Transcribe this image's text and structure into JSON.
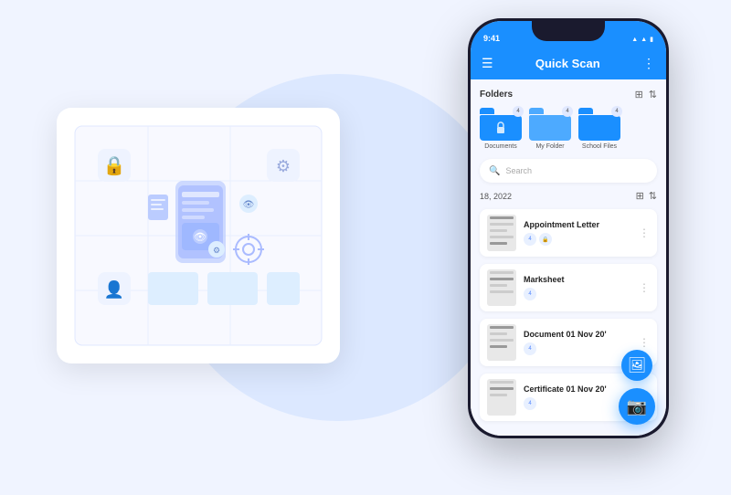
{
  "app": {
    "title": "Quick Scan",
    "status_time": "9:41",
    "menu_icon": "☰",
    "more_icon": "⋮"
  },
  "folders": {
    "section_title": "Folders",
    "items": [
      {
        "name": "Documents",
        "count": "4",
        "locked": true,
        "color": "dark"
      },
      {
        "name": "My Folder",
        "count": "4",
        "locked": false,
        "color": "light"
      },
      {
        "name": "School Files",
        "count": "4",
        "locked": false,
        "color": "dark"
      }
    ]
  },
  "search": {
    "placeholder": "Search"
  },
  "documents": {
    "date": "18, 2022",
    "items": [
      {
        "name": "Appointment Letter",
        "badges": [
          "4",
          "🔒"
        ]
      },
      {
        "name": "Marksheet",
        "badges": [
          "4"
        ]
      },
      {
        "name": "Document 01 Nov 20'",
        "badges": [
          "4"
        ]
      },
      {
        "name": "Certificate 01 Nov 20'",
        "badges": [
          "4"
        ]
      }
    ]
  },
  "fab": {
    "secondary_icon": "🖼",
    "primary_icon": "📷"
  },
  "colors": {
    "accent": "#1a8fff",
    "bg": "#f0f4ff",
    "circle": "#dce8ff"
  }
}
